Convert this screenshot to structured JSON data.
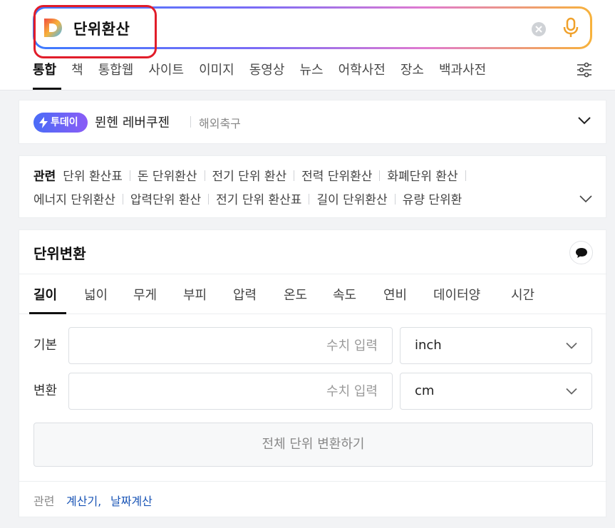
{
  "search": {
    "query": "단위환산",
    "icons": {
      "logo": "daum-d-logo",
      "clear": "clear-icon",
      "voice": "mic-icon"
    }
  },
  "nav_tabs": [
    "통합",
    "책",
    "통합웹",
    "사이트",
    "이미지",
    "동영상",
    "뉴스",
    "어학사전",
    "장소",
    "백과사전"
  ],
  "active_tab": "통합",
  "today": {
    "badge": "투데이",
    "title": "뮌헨 레버쿠젠",
    "category": "해외축구"
  },
  "related": {
    "heading": "관련",
    "line1": [
      "단위 환산표",
      "돈 단위환산",
      "전기 단위 환산",
      "전력 단위환산",
      "화폐단위 환산"
    ],
    "line2": [
      "에너지 단위환산",
      "압력단위 환산",
      "전기 단위 환산표",
      "길이 단위환산",
      "유량 단위환"
    ]
  },
  "converter": {
    "title": "단위변환",
    "tabs": [
      "길이",
      "넓이",
      "무게",
      "부피",
      "압력",
      "온도",
      "속도",
      "연비",
      "데이터양",
      "시간"
    ],
    "active_tab": "길이",
    "base_label": "기본",
    "target_label": "변환",
    "input_placeholder": "수치 입력",
    "base_unit": "inch",
    "target_unit": "cm",
    "convert_all_label": "전체 단위 변환하기",
    "footer_label": "관련",
    "footer_links": [
      "계산기,",
      "날짜계산"
    ]
  },
  "colors": {
    "accent_gradient": [
      "#3c7bff",
      "#7b6cf6",
      "#e07ad0",
      "#f7b23b"
    ],
    "highlight_box": "#e11d2a",
    "link": "#1a55b6"
  }
}
